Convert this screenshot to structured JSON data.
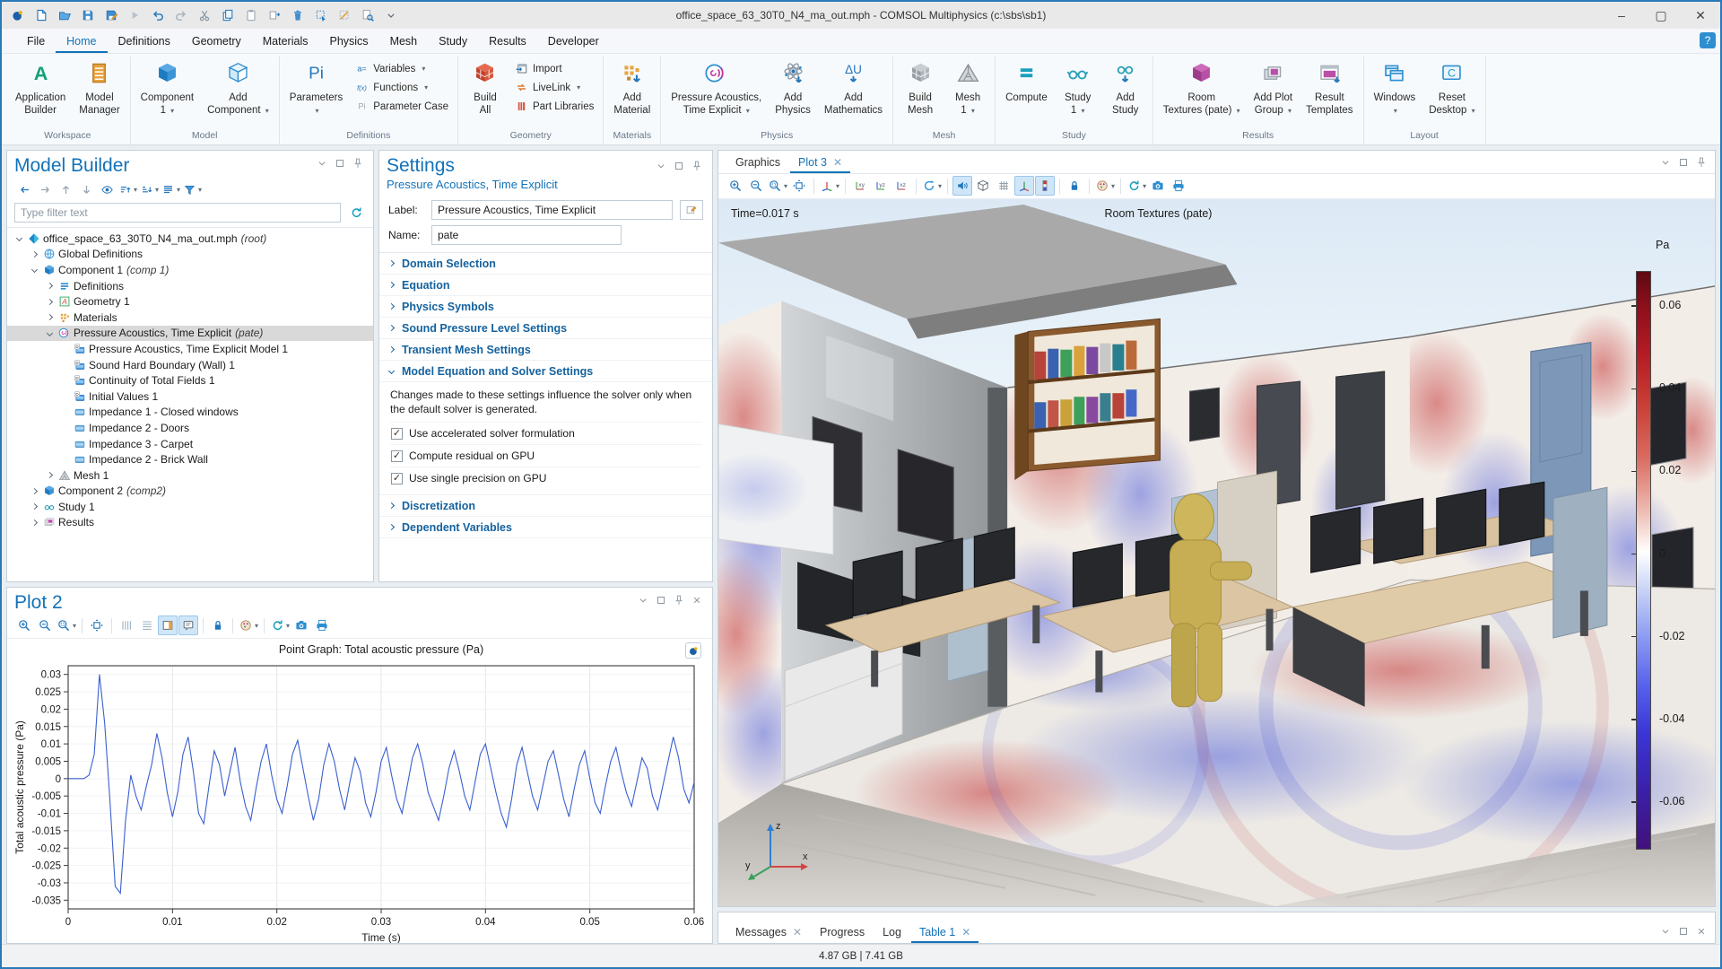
{
  "window": {
    "title": "office_space_63_30T0_N4_ma_out.mph - COMSOL Multiphysics (c:\\sbs\\sb1)",
    "controls": [
      "minimize",
      "maximize",
      "close"
    ],
    "help_label": "?"
  },
  "titlebar": {
    "icons": [
      "app-icon",
      "new-icon",
      "open-icon",
      "save-icon",
      "save-as-icon",
      "play-icon",
      "undo-icon",
      "redo-icon",
      "cut-icon",
      "copy-icon",
      "paste-icon",
      "duplicate-icon",
      "delete-icon",
      "select-icon",
      "deselect-icon",
      "find-icon",
      "more-icon"
    ]
  },
  "menu": {
    "items": [
      {
        "label": "File"
      },
      {
        "label": "Home",
        "active": true
      },
      {
        "label": "Definitions"
      },
      {
        "label": "Geometry"
      },
      {
        "label": "Materials"
      },
      {
        "label": "Physics"
      },
      {
        "label": "Mesh"
      },
      {
        "label": "Study"
      },
      {
        "label": "Results"
      },
      {
        "label": "Developer"
      }
    ]
  },
  "ribbon": {
    "groups": [
      {
        "label": "Workspace",
        "items": [
          {
            "l1": "Application",
            "l2": "Builder",
            "icon": "app-builder-icon"
          },
          {
            "l1": "Model",
            "l2": "Manager",
            "icon": "model-manager-icon"
          }
        ]
      },
      {
        "label": "Model",
        "items": [
          {
            "l1": "Component",
            "l2": "1",
            "icon": "component-icon",
            "caret": true
          },
          {
            "l1": "Add",
            "l2": "Component",
            "icon": "add-component-icon",
            "caret": true
          }
        ]
      },
      {
        "label": "Definitions",
        "items": [
          {
            "l1": "Parameters",
            "l2": "",
            "icon": "parameters-icon",
            "caret": true
          },
          {
            "stack": [
              {
                "label": "Variables",
                "icon": "variables-icon",
                "caret": true
              },
              {
                "label": "Functions",
                "icon": "functions-icon",
                "caret": true
              },
              {
                "label": "Parameter Case",
                "icon": "parameter-case-icon"
              }
            ]
          }
        ]
      },
      {
        "label": "Geometry",
        "items": [
          {
            "l1": "Build",
            "l2": "All",
            "icon": "build-all-icon"
          },
          {
            "stack": [
              {
                "label": "Import",
                "icon": "import-icon"
              },
              {
                "label": "LiveLink",
                "icon": "livelink-icon",
                "caret": true
              },
              {
                "label": "Part Libraries",
                "icon": "part-libraries-icon"
              }
            ]
          }
        ]
      },
      {
        "label": "Materials",
        "items": [
          {
            "l1": "Add",
            "l2": "Material",
            "icon": "add-material-icon"
          }
        ]
      },
      {
        "label": "Physics",
        "items": [
          {
            "l1": "Pressure Acoustics,",
            "l2": "Time Explicit",
            "icon": "pressure-acoustics-icon",
            "caret": true
          },
          {
            "l1": "Add",
            "l2": "Physics",
            "icon": "add-physics-icon"
          },
          {
            "l1": "Add",
            "l2": "Mathematics",
            "icon": "add-mathematics-icon"
          }
        ]
      },
      {
        "label": "Mesh",
        "items": [
          {
            "l1": "Build",
            "l2": "Mesh",
            "icon": "build-mesh-icon"
          },
          {
            "l1": "Mesh",
            "l2": "1",
            "icon": "mesh-icon",
            "caret": true
          }
        ]
      },
      {
        "label": "Study",
        "items": [
          {
            "l1": "Compute",
            "icon": "compute-icon"
          },
          {
            "l1": "Study",
            "l2": "1",
            "icon": "study-icon",
            "caret": true
          },
          {
            "l1": "Add",
            "l2": "Study",
            "icon": "add-study-icon"
          }
        ]
      },
      {
        "label": "Results",
        "items": [
          {
            "l1": "Room",
            "l2": "Textures (pate)",
            "icon": "room-textures-icon",
            "caret": true
          },
          {
            "l1": "Add Plot",
            "l2": "Group",
            "icon": "add-plot-group-icon",
            "caret": true
          },
          {
            "l1": "Result",
            "l2": "Templates",
            "icon": "result-templates-icon"
          }
        ]
      },
      {
        "label": "Layout",
        "items": [
          {
            "l1": "Windows",
            "l2": "",
            "icon": "windows-icon",
            "caret": true
          },
          {
            "l1": "Reset",
            "l2": "Desktop",
            "icon": "reset-desktop-icon",
            "caret": true
          }
        ]
      }
    ]
  },
  "model_builder": {
    "title": "Model Builder",
    "filter_placeholder": "Type filter text",
    "toolbar": [
      {
        "icon": "nav-back-icon"
      },
      {
        "icon": "nav-fwd-icon"
      },
      {
        "icon": "nav-up-icon"
      },
      {
        "icon": "nav-down-icon"
      },
      {
        "icon": "eye-icon"
      },
      {
        "icon": "sort-asc-icon",
        "caret": true
      },
      {
        "icon": "sort-desc-icon",
        "caret": true
      },
      {
        "icon": "columns-icon",
        "caret": true
      },
      {
        "icon": "funnel-icon",
        "caret": true
      }
    ],
    "tree": [
      {
        "icon": "root-icon",
        "label": "office_space_63_30T0_N4_ma_out.mph",
        "suffix": "(root)",
        "depth": 0,
        "exp": "open"
      },
      {
        "icon": "globe-icon",
        "label": "Global Definitions",
        "depth": 1,
        "exp": "closed"
      },
      {
        "icon": "component-small-icon",
        "label": "Component 1",
        "suffix": "(comp 1)",
        "depth": 1,
        "exp": "open"
      },
      {
        "icon": "definitions-icon",
        "label": "Definitions",
        "depth": 2,
        "exp": "closed"
      },
      {
        "icon": "geometry-icon",
        "label": "Geometry 1",
        "depth": 2,
        "exp": "closed"
      },
      {
        "icon": "materials-icon",
        "label": "Materials",
        "depth": 2,
        "exp": "closed"
      },
      {
        "icon": "acoustics-icon",
        "label": "Pressure Acoustics, Time Explicit",
        "suffix": "(pate)",
        "depth": 2,
        "exp": "open",
        "selected": true
      },
      {
        "icon": "dflag-icon",
        "label": "Pressure Acoustics, Time Explicit Model 1",
        "depth": 3
      },
      {
        "icon": "dflag-icon",
        "label": "Sound Hard Boundary (Wall) 1",
        "depth": 3
      },
      {
        "icon": "dflag-icon",
        "label": "Continuity of Total Fields 1",
        "depth": 3
      },
      {
        "icon": "dflag-icon",
        "label": "Initial Values 1",
        "depth": 3
      },
      {
        "icon": "boundary-icon",
        "label": "Impedance 1 - Closed windows",
        "depth": 3
      },
      {
        "icon": "boundary-icon",
        "label": "Impedance 2 - Doors",
        "depth": 3
      },
      {
        "icon": "boundary-icon",
        "label": "Impedance 3 - Carpet",
        "depth": 3
      },
      {
        "icon": "boundary-icon",
        "label": "Impedance 2 - Brick Wall",
        "depth": 3
      },
      {
        "icon": "mesh-small-icon",
        "label": "Mesh 1",
        "depth": 2,
        "exp": "closed"
      },
      {
        "icon": "component-small-icon",
        "label": "Component 2",
        "suffix": "(comp2)",
        "depth": 1,
        "exp": "closed"
      },
      {
        "icon": "study-small-icon",
        "label": "Study 1",
        "depth": 1,
        "exp": "closed"
      },
      {
        "icon": "results-icon",
        "label": "Results",
        "depth": 1,
        "exp": "closed"
      }
    ]
  },
  "settings": {
    "title": "Settings",
    "subtitle": "Pressure Acoustics, Time Explicit",
    "label_field": {
      "label": "Label:",
      "value": "Pressure Acoustics, Time Explicit"
    },
    "name_field": {
      "label": "Name:",
      "value": "pate"
    },
    "sections": [
      {
        "label": "Domain Selection"
      },
      {
        "label": "Equation"
      },
      {
        "label": "Physics Symbols"
      },
      {
        "label": "Sound Pressure Level Settings"
      },
      {
        "label": "Transient Mesh Settings"
      },
      {
        "label": "Model Equation and Solver Settings",
        "expanded": true
      },
      {
        "label": "Discretization"
      },
      {
        "label": "Dependent Variables"
      }
    ],
    "solver_note": "Changes made to these settings influence the solver only when the default solver is generated.",
    "checkboxes": [
      {
        "label": "Use accelerated solver formulation",
        "checked": true
      },
      {
        "label": "Compute residual on GPU",
        "checked": true
      },
      {
        "label": "Use single precision on GPU",
        "checked": true
      }
    ]
  },
  "plot2": {
    "title": "Plot 2",
    "toolbar": [
      {
        "icon": "zoom-in-icon"
      },
      {
        "icon": "zoom-out-icon"
      },
      {
        "icon": "zoom-box-icon",
        "caret": true
      },
      "|",
      {
        "icon": "zoom-extents-icon"
      },
      "|",
      {
        "icon": "ygrid-icon"
      },
      {
        "icon": "xgrid-icon"
      },
      {
        "icon": "legend-icon",
        "active": true
      },
      {
        "icon": "note-icon",
        "active": true
      },
      "|",
      {
        "icon": "lock-icon"
      },
      "|",
      {
        "icon": "palette-icon",
        "caret": true
      },
      "|",
      {
        "icon": "refresh-icon",
        "caret": true
      },
      {
        "icon": "camera-icon"
      },
      {
        "icon": "print-icon"
      }
    ]
  },
  "chart_data": {
    "type": "line",
    "title": "Point Graph: Total acoustic pressure (Pa)",
    "xlabel": "Time (s)",
    "ylabel": "Total acoustic pressure (Pa)",
    "xlim": [
      0,
      0.06
    ],
    "ylim": [
      -0.0375,
      0.0325
    ],
    "xticks": [
      0,
      0.01,
      0.02,
      0.03,
      0.04,
      0.05,
      0.06
    ],
    "yticks": [
      0.03,
      0.025,
      0.02,
      0.015,
      0.01,
      0.005,
      0,
      -0.005,
      -0.01,
      -0.015,
      -0.02,
      -0.025,
      -0.03,
      -0.035
    ],
    "grid": true,
    "legend": false,
    "line_color": "#3a5fd0",
    "series": [
      {
        "name": "Total acoustic pressure",
        "x0": 0,
        "dx": 0.0005,
        "y": [
          0,
          0,
          0,
          0,
          0.001,
          0.007,
          0.03,
          0.016,
          -0.006,
          -0.031,
          -0.033,
          -0.012,
          0.001,
          -0.005,
          -0.009,
          -0.002,
          0.004,
          0.013,
          0.006,
          -0.004,
          -0.011,
          -0.004,
          0.007,
          0.012,
          0.002,
          -0.01,
          -0.013,
          -0.002,
          0.008,
          0.004,
          -0.005,
          0.002,
          0.009,
          -0.001,
          -0.008,
          -0.012,
          -0.003,
          0.005,
          0.01,
          0.001,
          -0.006,
          -0.01,
          -0.002,
          0.007,
          0.011,
          0.003,
          -0.005,
          -0.012,
          -0.006,
          0.004,
          0.01,
          0.005,
          -0.003,
          -0.009,
          -0.001,
          0.006,
          0.002,
          -0.007,
          -0.011,
          -0.004,
          0.005,
          0.009,
          0.001,
          -0.006,
          -0.01,
          -0.002,
          0.006,
          0.01,
          0.004,
          -0.004,
          -0.008,
          -0.012,
          -0.005,
          0.003,
          0.008,
          0.002,
          -0.005,
          -0.009,
          -0.001,
          0.007,
          0.01,
          0.003,
          -0.004,
          -0.01,
          -0.014,
          -0.006,
          0.004,
          0.009,
          0.002,
          -0.005,
          -0.009,
          -0.002,
          0.005,
          0.008,
          0.001,
          -0.006,
          -0.011,
          -0.003,
          0.004,
          0.008,
          0.0,
          -0.007,
          -0.01,
          -0.002,
          0.005,
          0.009,
          0.002,
          -0.004,
          -0.008,
          -0.001,
          0.006,
          0.003,
          -0.005,
          -0.009,
          -0.002,
          0.005,
          0.012,
          0.006,
          -0.003,
          -0.007,
          -0.001
        ]
      }
    ]
  },
  "graphics": {
    "tabs": [
      {
        "label": "Graphics"
      },
      {
        "label": "Plot 3",
        "close": true,
        "active": true
      }
    ],
    "toolbar": [
      {
        "icon": "zoom-in-icon"
      },
      {
        "icon": "zoom-out-icon"
      },
      {
        "icon": "zoom-box-icon",
        "caret": true
      },
      {
        "icon": "zoom-extents-icon"
      },
      "|",
      {
        "icon": "go-default-view-icon",
        "caret": true
      },
      "|",
      {
        "icon": "view-xy-icon"
      },
      {
        "icon": "view-yz-icon"
      },
      {
        "icon": "view-xz-icon"
      },
      "|",
      {
        "icon": "rotate-icon",
        "caret": true
      },
      "|",
      {
        "icon": "speaker-icon",
        "active": true
      },
      {
        "icon": "scene-icon"
      },
      {
        "icon": "grid-icon"
      },
      {
        "icon": "orientation-icon",
        "active": true
      },
      {
        "icon": "colorbar-icon",
        "active": true
      },
      "|",
      {
        "icon": "lock-icon"
      },
      "|",
      {
        "icon": "palette-icon",
        "caret": true
      },
      "|",
      {
        "icon": "refresh-icon",
        "caret": true
      },
      {
        "icon": "camera-icon"
      },
      {
        "icon": "print-icon"
      }
    ],
    "time_label": "Time=0.017 s",
    "plot_title": "Room Textures (pate)",
    "colorbar": {
      "unit": "Pa",
      "vmax": 0.0685,
      "vmin": -0.0715,
      "ticks": [
        {
          "v": 0.06,
          "label": "0.06"
        },
        {
          "v": 0.04,
          "label": "0.04"
        },
        {
          "v": 0.02,
          "label": "0.02"
        },
        {
          "v": 0,
          "label": "0"
        },
        {
          "v": -0.02,
          "label": "-0.02"
        },
        {
          "v": -0.04,
          "label": "-0.04"
        },
        {
          "v": -0.06,
          "label": "-0.06"
        }
      ],
      "colors_top_to_bottom": [
        "#5f0a12",
        "#b31b24",
        "#ffffff",
        "#5560ea",
        "#43117c"
      ]
    },
    "axis_triad": {
      "x": "x",
      "y": "y",
      "z": "z"
    }
  },
  "bottom_tabs": [
    {
      "label": "Messages",
      "close": true
    },
    {
      "label": "Progress"
    },
    {
      "label": "Log"
    },
    {
      "label": "Table 1",
      "close": true,
      "active": true
    }
  ],
  "statusbar": {
    "memory": "4.87 GB | 7.41 GB"
  }
}
